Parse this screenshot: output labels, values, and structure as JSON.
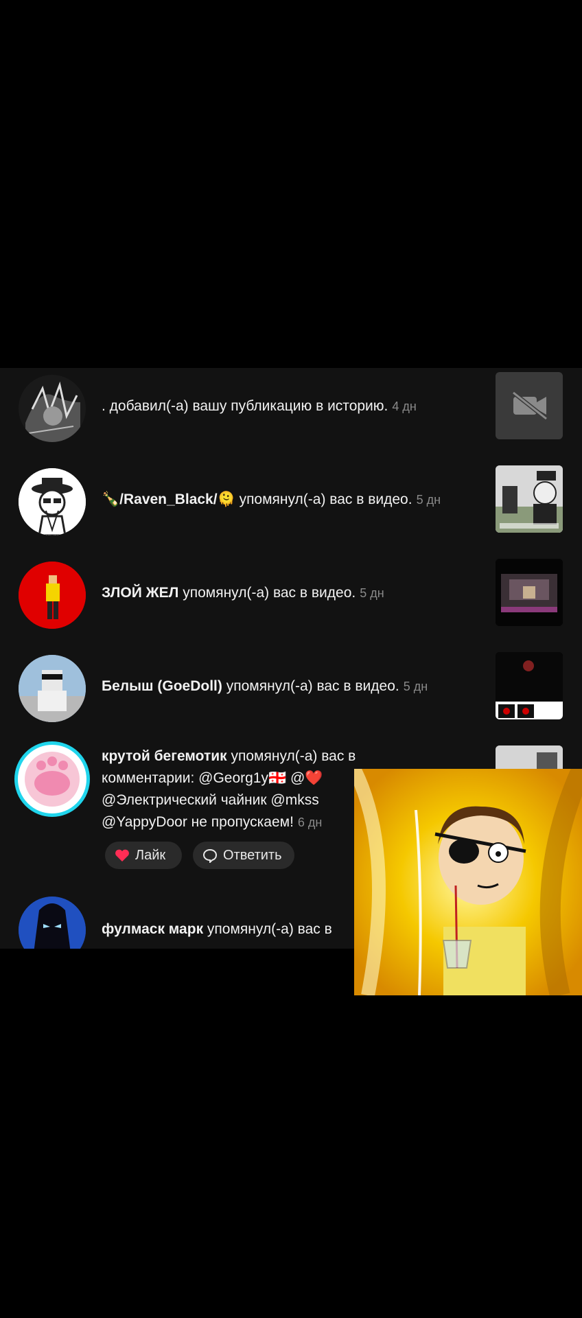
{
  "notifications": [
    {
      "name": "",
      "action": ". добавил(-а) вашу публикацию в историю.",
      "time": "4 дн",
      "thumb_icon": "video-off-icon"
    },
    {
      "name": "🍾/Raven_Black/🫠",
      "action": "упомянул(-а) вас в видео.",
      "time": "5 дн"
    },
    {
      "name": "ЗЛОЙ ЖЕЛ",
      "action": "упомянул(-а) вас в видео.",
      "time": "5 дн"
    },
    {
      "name": "Белыш (GoeDoll)",
      "action": "упомянул(-а) вас в видео.",
      "time": "5 дн"
    },
    {
      "name": "крутой бегемотик",
      "action_line1": "упомянул(-а) вас в",
      "line2": "комментарии: @Georg1y🇬🇪 @❤️",
      "line3": "@Электрический чайник @mkss",
      "line4": "@YappyDoor не пропускаем!",
      "time": "6 дн",
      "like_label": "Лайк",
      "reply_label": "Ответить"
    },
    {
      "name": "фулмаск марк",
      "action": "упомянул(-а) вас в"
    }
  ],
  "icons": {
    "like": "heart-icon",
    "reply": "speech-bubble-icon"
  },
  "colors": {
    "background": "#000000",
    "panel": "#121212",
    "like_heart": "#ff2d55",
    "story_ring": "#20d5ec"
  }
}
